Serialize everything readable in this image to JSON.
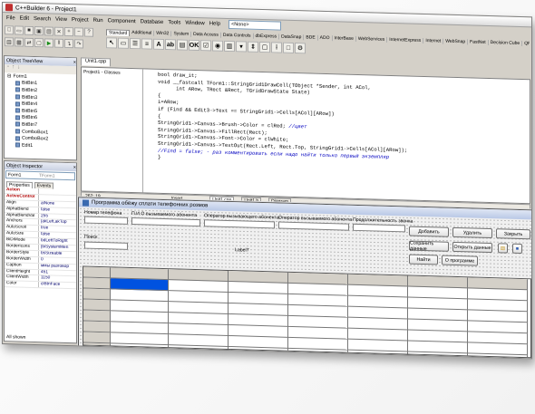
{
  "app": {
    "title": "C++Builder 6 - Project1"
  },
  "menu": [
    "File",
    "Edit",
    "Search",
    "View",
    "Project",
    "Run",
    "Component",
    "Database",
    "Tools",
    "Window",
    "Help"
  ],
  "toolbar": {
    "desktop_combo": "<None>"
  },
  "palette_tabs": [
    "Standard",
    "Additional",
    "Win32",
    "System",
    "Data Access",
    "Data Controls",
    "dbExpress",
    "DataSnap",
    "BDE",
    "ADO",
    "InterBase",
    "WebServices",
    "InternetExpress",
    "Internet",
    "WebSnap",
    "FastNet",
    "Decision Cube",
    "QReport"
  ],
  "tree_view": {
    "title": "Object TreeView",
    "root": "Form1",
    "items": [
      "BitBtn1",
      "BitBtn2",
      "BitBtn3",
      "BitBtn4",
      "BitBtn5",
      "BitBtn6",
      "BitBtn7",
      "ComboBox1",
      "ComboBox2",
      "Edit1"
    ]
  },
  "inspector": {
    "title": "Object Inspector",
    "object": "Form1",
    "object_type": "TForm1",
    "tabs": [
      "Properties",
      "Events"
    ],
    "rows": [
      {
        "k": "Action",
        "v": "",
        "cat": true
      },
      {
        "k": "ActiveControl",
        "v": "",
        "cat": true
      },
      {
        "k": "Align",
        "v": "alNone"
      },
      {
        "k": "AlphaBlend",
        "v": "false"
      },
      {
        "k": "AlphaBlendVal",
        "v": "255"
      },
      {
        "k": "Anchors",
        "v": "[akLeft,akTop"
      },
      {
        "k": "AutoScroll",
        "v": "true"
      },
      {
        "k": "AutoSize",
        "v": "false"
      },
      {
        "k": "BiDiMode",
        "v": "bdLeftToRight"
      },
      {
        "k": "BorderIcons",
        "v": "[biSystemMen"
      },
      {
        "k": "BorderStyle",
        "v": "bsSizeable"
      },
      {
        "k": "BorderWidth",
        "v": "0"
      },
      {
        "k": "Caption",
        "v": "ммы разговор"
      },
      {
        "k": "ClientHeight",
        "v": "451"
      },
      {
        "k": "ClientWidth",
        "v": "1150"
      },
      {
        "k": "Color",
        "v": "clBtnFace"
      }
    ],
    "footer": "All shown"
  },
  "editor": {
    "tabs": [
      "Unit1.cpp"
    ],
    "active_tab": "Unit1.cpp",
    "class_tree_root": "Project1 - Classes",
    "code_lines": [
      "bool draw_it;",
      "void __fastcall TForm1::StringGrid1DrawCell(TObject *Sender, int ACol,",
      "      int ARow, TRect &Rect, TGridDrawState State)",
      "{",
      "i=ARow;",
      "",
      "if (Find && Edit3->Text == StringGrid1->Cells[ACol][ARow])",
      "{",
      "StringGrid1->Canvas->Brush->Color = clRed; //цвет",
      "StringGrid1->Canvas->FillRect(Rect);",
      "StringGrid1->Canvas->Font->Color = clWhite;",
      "StringGrid1->Canvas->TextOut(Rect.Left, Rect.Top, StringGrid1->Cells[ACol][ARow]);",
      "//Find = false; - раз комментировать если надо найти только первый экземпляр",
      "}"
    ],
    "comment_marker": "//",
    "status": {
      "position": "262: 19",
      "mode": "Insert",
      "tabs": [
        "Unit1.cpp",
        "Unit1.h",
        "Diagram"
      ]
    }
  },
  "form": {
    "title": "Программа обёжу сплати телефонних розмов",
    "headers": [
      "Номер телефона",
      "П.И.О вызываемого абонента",
      "Оператор вызывающего абонента",
      "Оператор вызываемого абонента",
      "Продолжительность звонка"
    ],
    "buttons": {
      "add": "Добавить",
      "delete": "Удалить",
      "close": "Закрыть",
      "save": "Сохранить данные",
      "open": "Открыть данные",
      "find": "Найти",
      "about": "О программе"
    },
    "search_label": "Поиск",
    "label7": "Label7"
  }
}
